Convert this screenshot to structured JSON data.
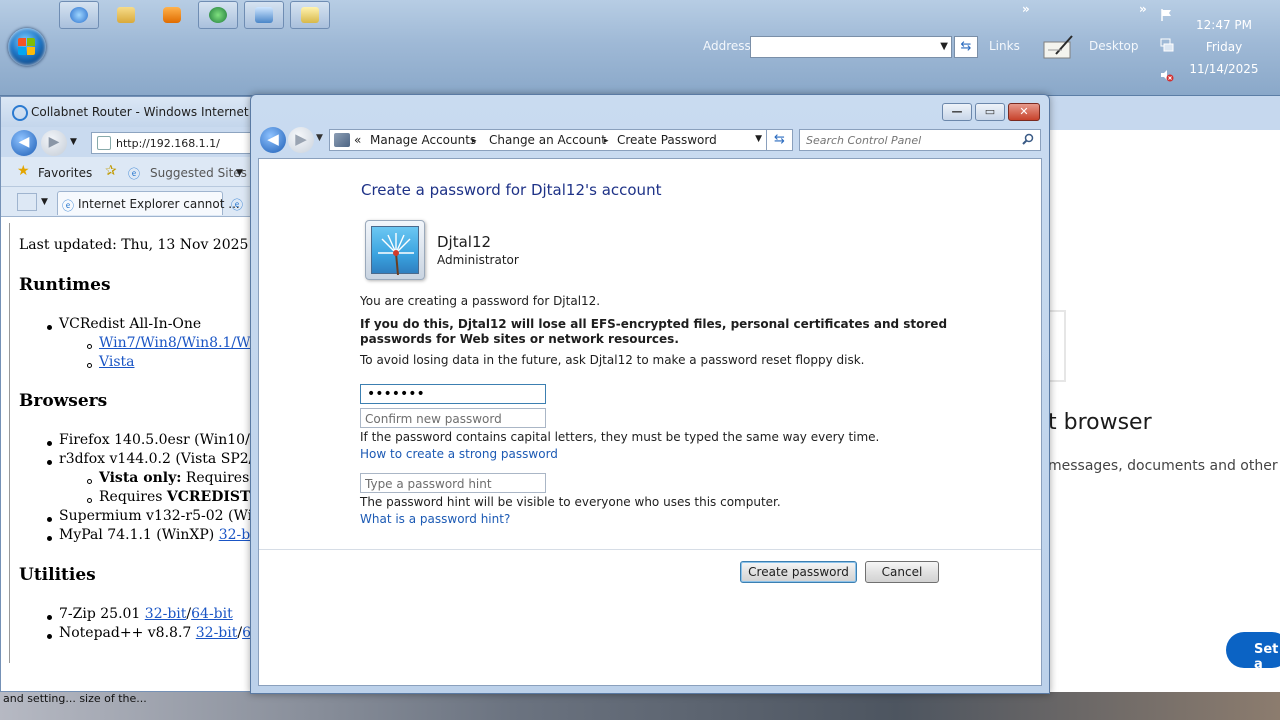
{
  "taskbar": {
    "address_label": "Address",
    "address_value": "",
    "links_label": "Links",
    "desktop_label": "Desktop",
    "overflow_glyph": "»",
    "clock": {
      "time": "12:47 PM",
      "day": "Friday",
      "date": "11/14/2025"
    },
    "quick_launch": [
      "internet-explorer-icon",
      "folder-icon",
      "media-player-icon",
      "browser-icon",
      "display-icon",
      "paint-icon"
    ]
  },
  "ie": {
    "title": "Collabnet Router - Windows Internet Explo",
    "url": "http://192.168.1.1/",
    "favorites_label": "Favorites",
    "suggested_sites_label": "Suggested Sites",
    "tab_label": "Internet Explorer cannot ...",
    "content": {
      "last_updated": "Last updated: Thu, 13 Nov 2025 05:0",
      "h_runtimes": "Runtimes",
      "vcredist": "VCRedist All-In-One",
      "vcredist_link1": "Win7/Win8/Win8.1/Win1",
      "vcredist_link2": "Vista",
      "h_browsers": "Browsers",
      "firefox": "Firefox 140.5.0esr (Win10/Win",
      "r3dfox": "r3dfox v144.0.2 (Vista SP2/Wi",
      "vista_only_bold": "Vista only:",
      "vista_only_rest": " Requires KE",
      "requires_plain": "Requires ",
      "requires_bold": "VCREDIST A",
      "supermium": "Supermium v132-r5-02 (WinXI",
      "mypal": "MyPal 74.1.1 (WinXP) ",
      "mypal_link": "32-bit/6",
      "h_utilities": "Utilities",
      "zip": "7-Zip 25.01 ",
      "zip_link1": "32-bit",
      "zip_link2": "64-bit",
      "notepad": "Notepad++ v8.8.7 ",
      "notepad_link1": "32-bit",
      "notepad_link2": "64-bi"
    },
    "status_text": "and setting...   size of the..."
  },
  "right_browser": {
    "heading": "t browser",
    "paragraph": "messages, documents and other ap",
    "button_label": "Set a"
  },
  "control_panel": {
    "breadcrumb": {
      "prefix": "«",
      "items": [
        "Manage Accounts",
        "Change an Account",
        "Create Password"
      ],
      "separator": "▸"
    },
    "search_placeholder": "Search Control Panel",
    "heading": "Create a password for Djtal12's account",
    "user_name": "Djtal12",
    "user_role": "Administrator",
    "info_line": "You are creating a password for Djtal12.",
    "warning": "If you do this, Djtal12 will lose all EFS-encrypted files, personal certificates and stored passwords for Web sites or network resources.",
    "floppy_note": "To avoid losing data in the future, ask Djtal12 to make a password reset floppy disk.",
    "new_password_masked": "•••••••",
    "confirm_placeholder": "Confirm new password",
    "caps_note": "If the password contains capital letters, they must be typed the same way every time.",
    "strong_link": "How to create a strong password",
    "hint_placeholder": "Type a password hint",
    "hint_note": "The password hint will be visible to everyone who uses this computer.",
    "hint_link": "What is a password hint?",
    "create_button": "Create password",
    "cancel_button": "Cancel"
  },
  "colors": {
    "heading_blue": "#1e3287",
    "link_blue": "#1c5ab4",
    "window_frame": "#c9dbf0",
    "close_red": "#c7422b"
  }
}
